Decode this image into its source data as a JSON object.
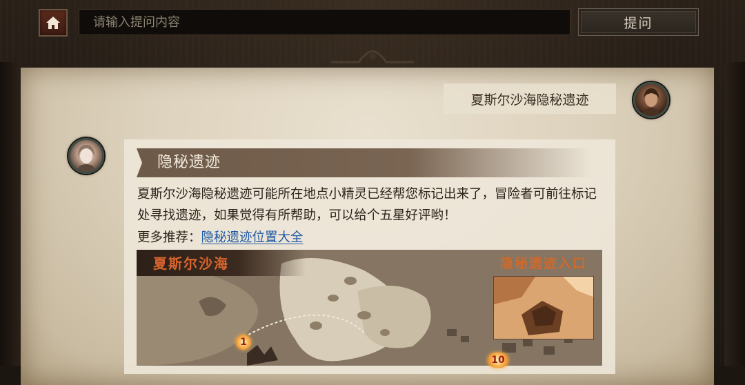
{
  "top_bar": {
    "search_placeholder": "请输入提问内容",
    "ask_button": "提问"
  },
  "chat": {
    "question": "夏斯尔沙海隐秘遗迹",
    "answer": {
      "title": "隐秘遗迹",
      "body": "夏斯尔沙海隐秘遗迹可能所在地点小精灵已经帮您标记出来了，冒险者可前往标记处寻找遗迹，如果觉得有所帮助，可以给个五星好评哟！",
      "more_prefix": "更多推荐：",
      "more_link": "隐秘遗迹位置大全"
    }
  },
  "map": {
    "region_label": "夏斯尔沙海",
    "entrance_label": "隐秘遗迹入口",
    "markers": [
      "1",
      "10"
    ]
  },
  "icons": {
    "home": "home-icon",
    "user_avatar": "user-avatar",
    "bot_avatar": "assistant-avatar"
  },
  "colors": {
    "accent_orange": "#d8652e",
    "link_blue": "#1f5aa6",
    "home_button": "#5b2a1d"
  }
}
